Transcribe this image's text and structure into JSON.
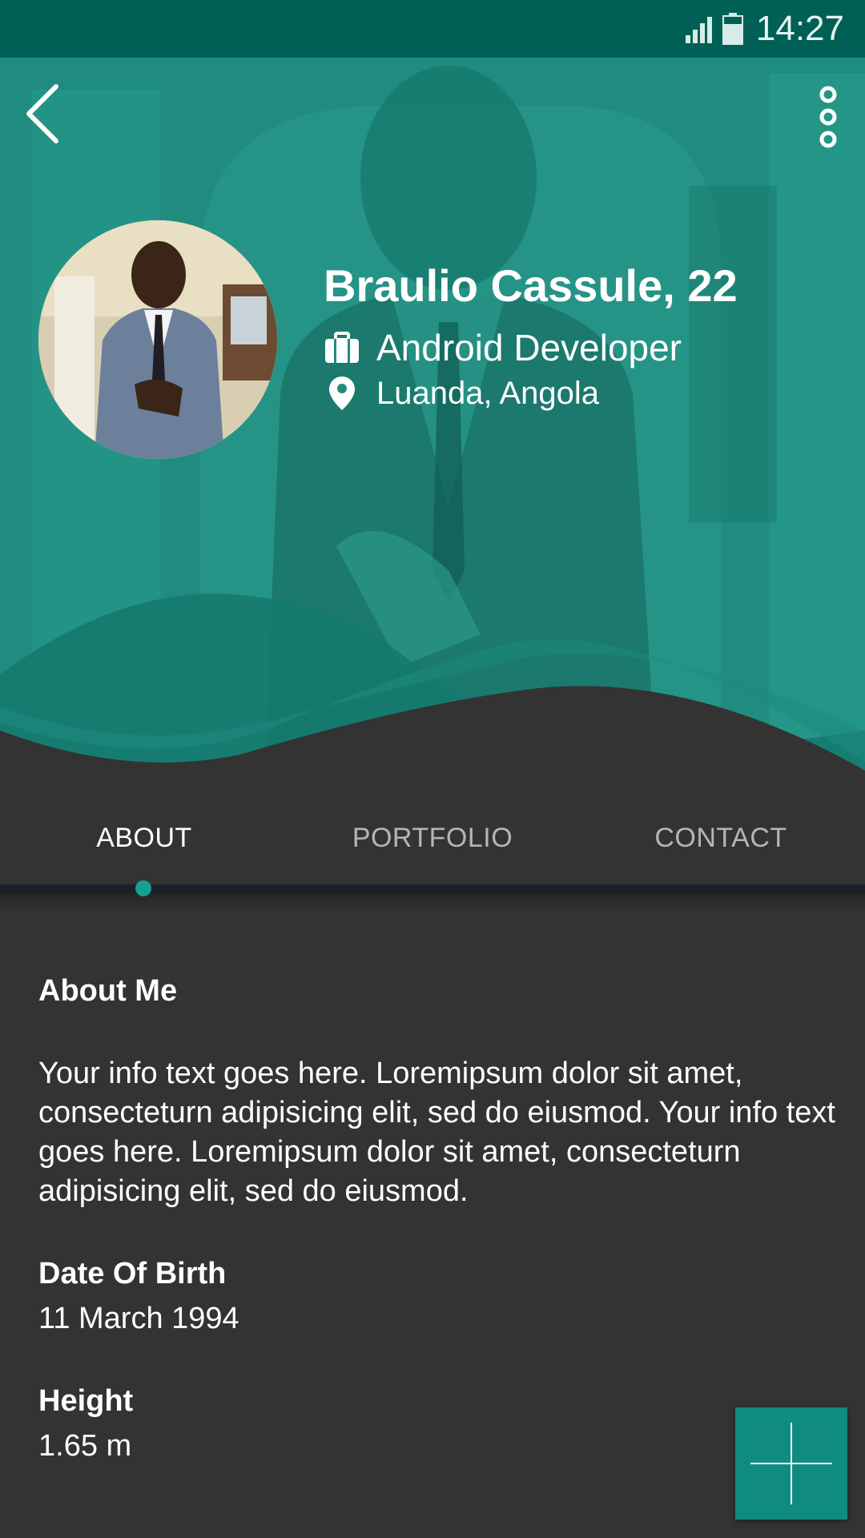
{
  "status_bar": {
    "time": "14:27",
    "icons": [
      "signal-icon",
      "battery-icon"
    ]
  },
  "header": {
    "back_icon": "chevron-left-icon",
    "more_icon": "more-vertical-icon",
    "name": "Braulio Cassule, 22",
    "job_icon": "briefcase-icon",
    "job": "Android Developer",
    "location_icon": "location-pin-icon",
    "location": "Luanda, Angola"
  },
  "tabs": [
    {
      "label": "ABOUT",
      "active": true
    },
    {
      "label": "PORTFOLIO",
      "active": false
    },
    {
      "label": "CONTACT",
      "active": false
    }
  ],
  "about": {
    "title": "About Me",
    "text": "Your info text goes here. Loremipsum dolor sit amet, consecteturn adipisicing elit, sed do eiusmod. Your info text goes here. Loremipsum dolor sit amet, consecteturn adipisicing elit, sed do eiusmod.",
    "dob_label": "Date Of Birth",
    "dob_value": "11 March 1994",
    "height_label": "Height",
    "height_value": "1.65 m"
  },
  "fab": {
    "icon": "plus-icon"
  },
  "colors": {
    "status_bar": "#006055",
    "header_tint": "#1f8c7f",
    "accent": "#16a08e",
    "background": "#333333",
    "fab": "#0f8c7f"
  }
}
